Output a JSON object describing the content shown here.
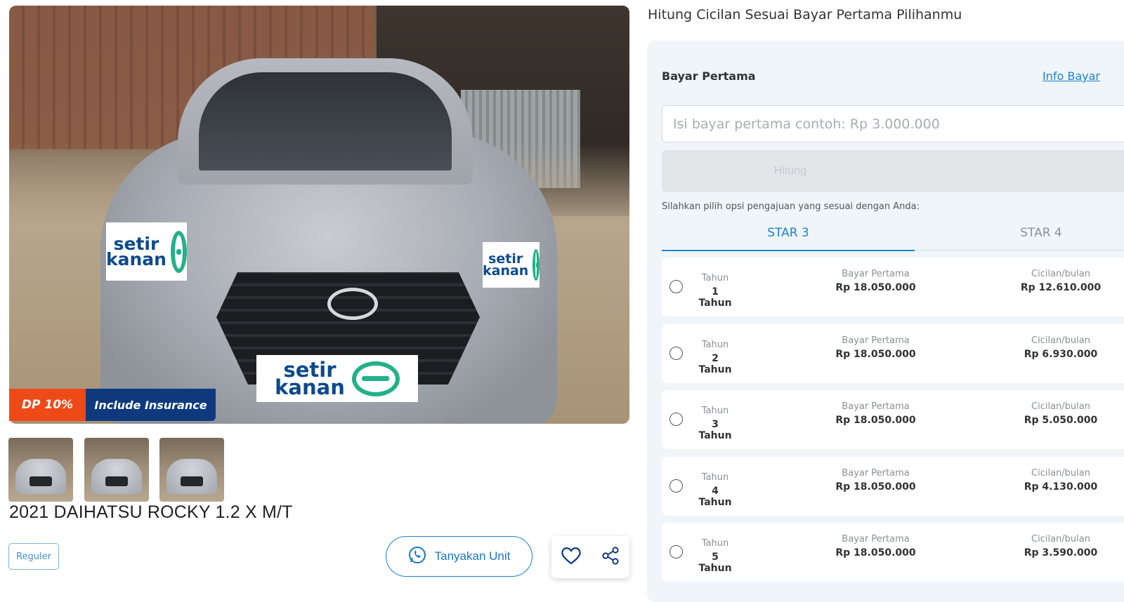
{
  "hero": {
    "badge_dp": "DP 10%",
    "badge_insurance": "Include Insurance",
    "logo_top": "setir",
    "logo_bottom": "kanan"
  },
  "product": {
    "title": "2021 DAIHATSU ROCKY 1.2 X M/T",
    "chip": "Reguler",
    "ask_button": "Tanyakan Unit"
  },
  "calculator": {
    "heading": "Hitung Cicilan Sesuai Bayar Pertama Pilihanmu",
    "bayar_label": "Bayar Pertama",
    "info_link": "Info Bayar",
    "input_placeholder": "Isi bayar pertama contoh: Rp 3.000.000",
    "hitung_label": "Hitung",
    "hint": "Silahkan pilih opsi pengajuan yang sesuai dengan Anda:",
    "tabs": [
      "STAR 3",
      "STAR 4"
    ],
    "rows": [
      {
        "tahun_label": "Tahun",
        "tahun": "1 Tahun",
        "bayar_label": "Bayar Pertama",
        "bayar": "Rp 18.050.000",
        "cicilan_label": "Cicilan/bulan",
        "cicilan": "Rp 12.610.000"
      },
      {
        "tahun_label": "Tahun",
        "tahun": "2 Tahun",
        "bayar_label": "Bayar Pertama",
        "bayar": "Rp 18.050.000",
        "cicilan_label": "Cicilan/bulan",
        "cicilan": "Rp 6.930.000"
      },
      {
        "tahun_label": "Tahun",
        "tahun": "3 Tahun",
        "bayar_label": "Bayar Pertama",
        "bayar": "Rp 18.050.000",
        "cicilan_label": "Cicilan/bulan",
        "cicilan": "Rp 5.050.000"
      },
      {
        "tahun_label": "Tahun",
        "tahun": "4 Tahun",
        "bayar_label": "Bayar Pertama",
        "bayar": "Rp 18.050.000",
        "cicilan_label": "Cicilan/bulan",
        "cicilan": "Rp 4.130.000"
      },
      {
        "tahun_label": "Tahun",
        "tahun": "5 Tahun",
        "bayar_label": "Bayar Pertama",
        "bayar": "Rp 18.050.000",
        "cicilan_label": "Cicilan/bulan",
        "cicilan": "Rp 3.590.000"
      }
    ]
  },
  "colors": {
    "accent": "#1a82d6",
    "dp_badge": "#ee4a18",
    "insurance_badge": "#0e3a7d",
    "logo_green": "#23b08a",
    "logo_blue": "#0d4a8c"
  },
  "icons": [
    "whatsapp-icon",
    "heart-icon",
    "share-icon"
  ]
}
